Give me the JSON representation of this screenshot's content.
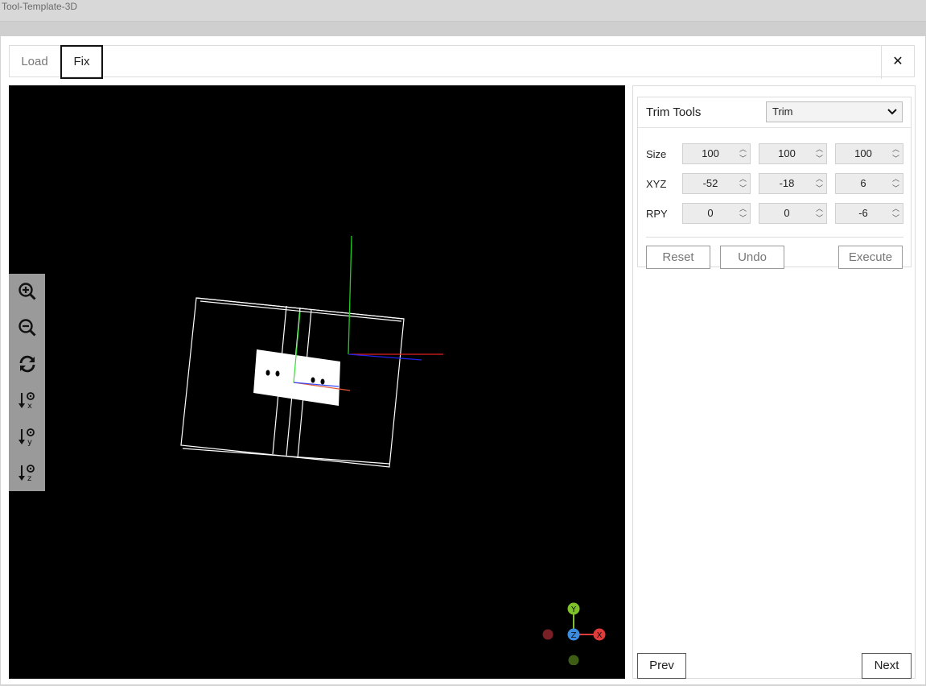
{
  "app": {
    "title": "Tool-Template-3D"
  },
  "tabs": [
    {
      "label": "Load",
      "active": false
    },
    {
      "label": "Fix",
      "active": true
    }
  ],
  "close_icon": "close-icon",
  "toolbar": [
    {
      "name": "zoom-in-icon"
    },
    {
      "name": "zoom-out-icon"
    },
    {
      "name": "reset-view-icon"
    },
    {
      "name": "view-x-icon"
    },
    {
      "name": "view-y-icon"
    },
    {
      "name": "view-z-icon"
    }
  ],
  "axis_gizmo": {
    "y": "Y",
    "z": "Z",
    "x": "X"
  },
  "trim": {
    "title": "Trim Tools",
    "mode": "Trim",
    "rows": [
      {
        "label": "Size",
        "values": [
          "100",
          "100",
          "100"
        ]
      },
      {
        "label": "XYZ",
        "values": [
          "-52",
          "-18",
          "6"
        ]
      },
      {
        "label": "RPY",
        "values": [
          "0",
          "0",
          "-6"
        ]
      }
    ],
    "reset_label": "Reset",
    "undo_label": "Undo",
    "execute_label": "Execute"
  },
  "nav": {
    "prev_label": "Prev",
    "next_label": "Next"
  },
  "colors": {
    "viewport_bg": "#000000",
    "toolbar_bg": "#9a9a9a",
    "axis_x": "#e03b3b",
    "axis_y": "#7ec12b",
    "axis_z": "#3b8be0"
  }
}
